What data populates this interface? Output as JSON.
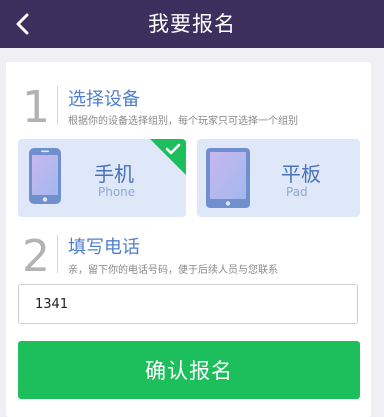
{
  "header": {
    "title": "我要报名"
  },
  "step1": {
    "number": "1",
    "title": "选择设备",
    "subtitle": "根据你的设备选择组别，每个玩家只可选择一个组别"
  },
  "devices": [
    {
      "name": "手机",
      "en": "Phone",
      "selected": true
    },
    {
      "name": "平板",
      "en": "Pad",
      "selected": false
    }
  ],
  "step2": {
    "number": "2",
    "title": "填写电话",
    "subtitle": "亲，留下你的电话号码，便于后续人员与您联系"
  },
  "phone_input": {
    "value": "1341"
  },
  "confirm_button": {
    "label": "确认报名"
  },
  "colors": {
    "header_bg": "#3c2f5e",
    "accent_green": "#1dbf5c",
    "device_bg": "#dfe8f9",
    "title_blue": "#4f7fcb"
  }
}
